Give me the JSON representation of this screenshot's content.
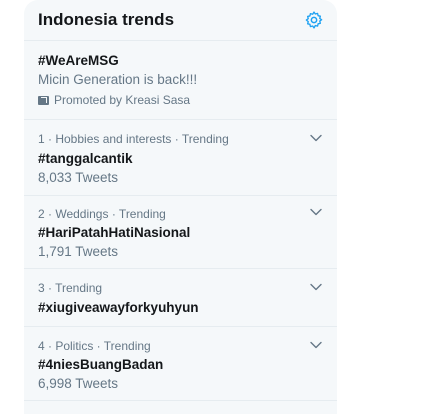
{
  "header": {
    "title": "Indonesia trends",
    "settings_icon": "gear-icon",
    "accent_color": "#1da1f2"
  },
  "promoted": {
    "tag": "#WeAreMSG",
    "description": "Micin Generation is back!!!",
    "promoted_by": "Promoted by Kreasi Sasa",
    "icon": "promoted-icon"
  },
  "trends": [
    {
      "meta": "1 · Hobbies and interests · Trending",
      "tag": "#tanggalcantik",
      "count": "8,033 Tweets"
    },
    {
      "meta": "2 · Weddings · Trending",
      "tag": "#HariPatahHatiNasional",
      "count": "1,791 Tweets"
    },
    {
      "meta": "3 · Trending",
      "tag": "#xiugiveawayforkyuhyun",
      "count": ""
    },
    {
      "meta": "4 · Politics · Trending",
      "tag": "#4niesBuangBadan",
      "count": "6,998 Tweets"
    }
  ]
}
